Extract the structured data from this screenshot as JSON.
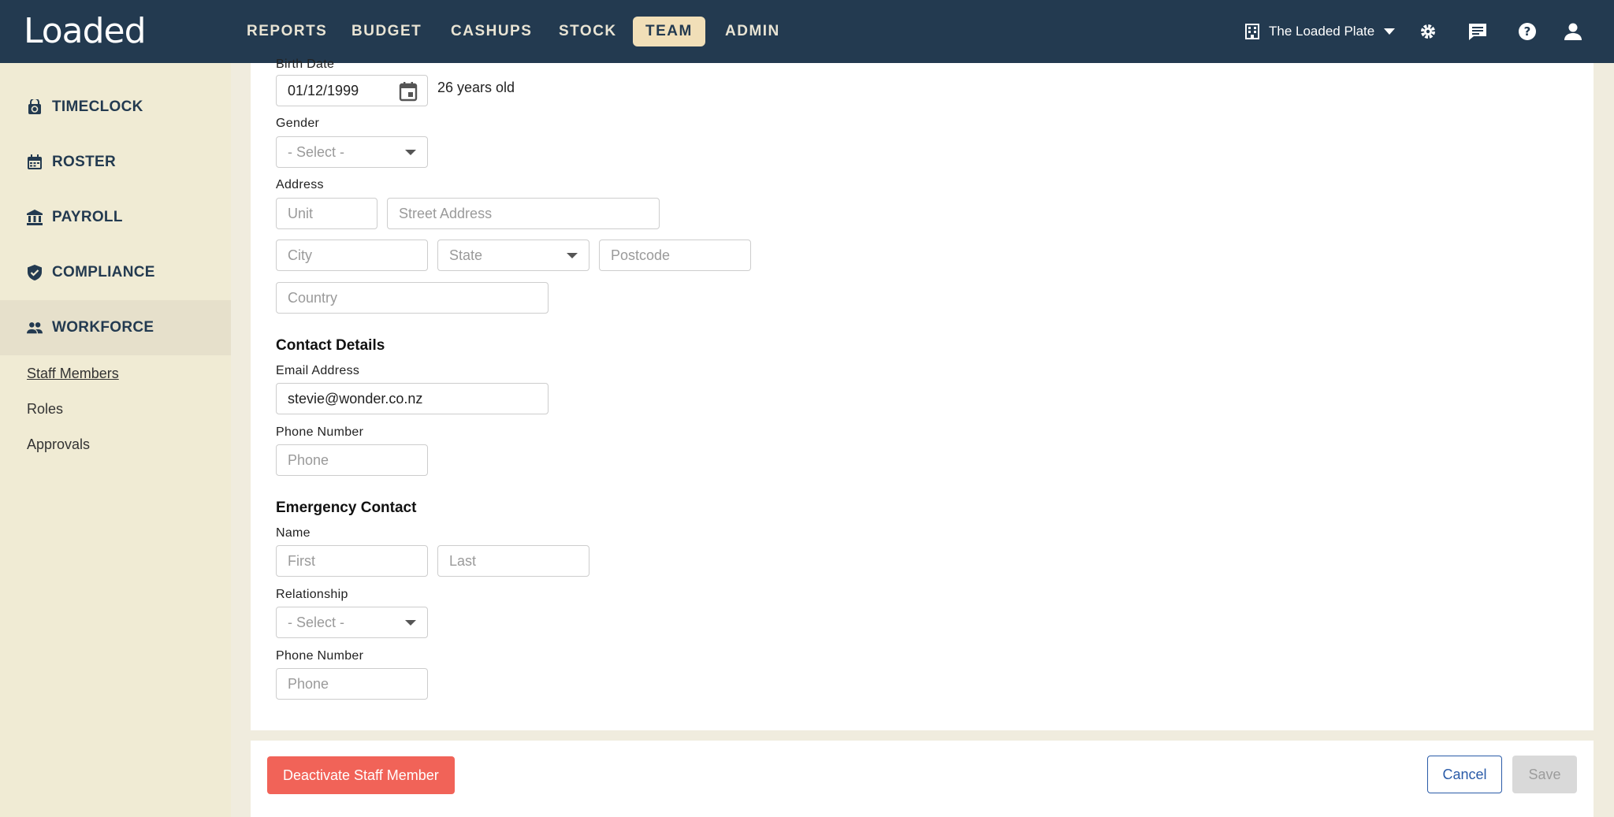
{
  "app": {
    "logo": "Loaded",
    "nav": [
      "REPORTS",
      "BUDGET",
      "CASHUPS",
      "STOCK",
      "TEAM",
      "ADMIN"
    ],
    "active_nav": "TEAM",
    "venue": "The Loaded Plate"
  },
  "sidebar": {
    "items": [
      {
        "label": "TIMECLOCK",
        "icon": "lock-timer-icon"
      },
      {
        "label": "ROSTER",
        "icon": "calendar-icon"
      },
      {
        "label": "PAYROLL",
        "icon": "bank-icon"
      },
      {
        "label": "COMPLIANCE",
        "icon": "shield-check-icon"
      },
      {
        "label": "WORKFORCE",
        "icon": "people-icon"
      }
    ],
    "sublinks": [
      "Staff Members",
      "Roles",
      "Approvals"
    ]
  },
  "form": {
    "birth_date": {
      "label": "Birth Date",
      "value": "01/12/1999",
      "age": "26 years old"
    },
    "gender": {
      "label": "Gender",
      "value": "- Select -"
    },
    "address": {
      "label": "Address",
      "unit_placeholder": "Unit",
      "street_placeholder": "Street Address",
      "city_placeholder": "City",
      "state_placeholder": "State",
      "postcode_placeholder": "Postcode",
      "country_placeholder": "Country"
    },
    "contact": {
      "title": "Contact Details",
      "email_label": "Email Address",
      "email_value": "stevie@wonder.co.nz",
      "phone_label": "Phone Number",
      "phone_placeholder": "Phone"
    },
    "emergency": {
      "title": "Emergency Contact",
      "name_label": "Name",
      "first_placeholder": "First",
      "last_placeholder": "Last",
      "relationship_label": "Relationship",
      "relationship_value": "- Select -",
      "phone_label": "Phone Number",
      "phone_placeholder": "Phone"
    }
  },
  "footer": {
    "deactivate": "Deactivate Staff Member",
    "cancel": "Cancel",
    "save": "Save"
  },
  "colors": {
    "nav_bg": "#233a50",
    "accent": "#f1dfb8",
    "sidebar_bg": "#f0ebd4",
    "danger": "#f16358",
    "link": "#2a5ba8"
  }
}
